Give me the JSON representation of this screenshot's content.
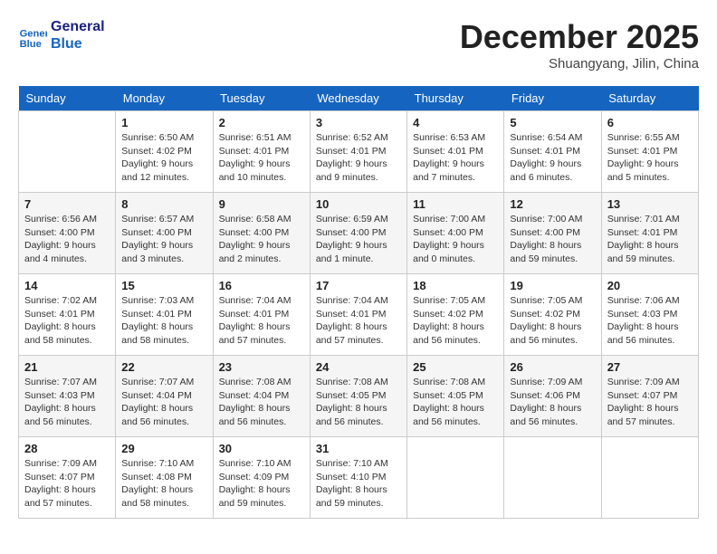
{
  "header": {
    "logo_line1": "General",
    "logo_line2": "Blue",
    "month": "December 2025",
    "location": "Shuangyang, Jilin, China"
  },
  "weekdays": [
    "Sunday",
    "Monday",
    "Tuesday",
    "Wednesday",
    "Thursday",
    "Friday",
    "Saturday"
  ],
  "weeks": [
    [
      {
        "day": null
      },
      {
        "day": 1,
        "sunrise": "6:50 AM",
        "sunset": "4:02 PM",
        "daylight": "9 hours and 12 minutes."
      },
      {
        "day": 2,
        "sunrise": "6:51 AM",
        "sunset": "4:01 PM",
        "daylight": "9 hours and 10 minutes."
      },
      {
        "day": 3,
        "sunrise": "6:52 AM",
        "sunset": "4:01 PM",
        "daylight": "9 hours and 9 minutes."
      },
      {
        "day": 4,
        "sunrise": "6:53 AM",
        "sunset": "4:01 PM",
        "daylight": "9 hours and 7 minutes."
      },
      {
        "day": 5,
        "sunrise": "6:54 AM",
        "sunset": "4:01 PM",
        "daylight": "9 hours and 6 minutes."
      },
      {
        "day": 6,
        "sunrise": "6:55 AM",
        "sunset": "4:01 PM",
        "daylight": "9 hours and 5 minutes."
      }
    ],
    [
      {
        "day": 7,
        "sunrise": "6:56 AM",
        "sunset": "4:00 PM",
        "daylight": "9 hours and 4 minutes."
      },
      {
        "day": 8,
        "sunrise": "6:57 AM",
        "sunset": "4:00 PM",
        "daylight": "9 hours and 3 minutes."
      },
      {
        "day": 9,
        "sunrise": "6:58 AM",
        "sunset": "4:00 PM",
        "daylight": "9 hours and 2 minutes."
      },
      {
        "day": 10,
        "sunrise": "6:59 AM",
        "sunset": "4:00 PM",
        "daylight": "9 hours and 1 minute."
      },
      {
        "day": 11,
        "sunrise": "7:00 AM",
        "sunset": "4:00 PM",
        "daylight": "9 hours and 0 minutes."
      },
      {
        "day": 12,
        "sunrise": "7:00 AM",
        "sunset": "4:00 PM",
        "daylight": "8 hours and 59 minutes."
      },
      {
        "day": 13,
        "sunrise": "7:01 AM",
        "sunset": "4:01 PM",
        "daylight": "8 hours and 59 minutes."
      }
    ],
    [
      {
        "day": 14,
        "sunrise": "7:02 AM",
        "sunset": "4:01 PM",
        "daylight": "8 hours and 58 minutes."
      },
      {
        "day": 15,
        "sunrise": "7:03 AM",
        "sunset": "4:01 PM",
        "daylight": "8 hours and 58 minutes."
      },
      {
        "day": 16,
        "sunrise": "7:04 AM",
        "sunset": "4:01 PM",
        "daylight": "8 hours and 57 minutes."
      },
      {
        "day": 17,
        "sunrise": "7:04 AM",
        "sunset": "4:01 PM",
        "daylight": "8 hours and 57 minutes."
      },
      {
        "day": 18,
        "sunrise": "7:05 AM",
        "sunset": "4:02 PM",
        "daylight": "8 hours and 56 minutes."
      },
      {
        "day": 19,
        "sunrise": "7:05 AM",
        "sunset": "4:02 PM",
        "daylight": "8 hours and 56 minutes."
      },
      {
        "day": 20,
        "sunrise": "7:06 AM",
        "sunset": "4:03 PM",
        "daylight": "8 hours and 56 minutes."
      }
    ],
    [
      {
        "day": 21,
        "sunrise": "7:07 AM",
        "sunset": "4:03 PM",
        "daylight": "8 hours and 56 minutes."
      },
      {
        "day": 22,
        "sunrise": "7:07 AM",
        "sunset": "4:04 PM",
        "daylight": "8 hours and 56 minutes."
      },
      {
        "day": 23,
        "sunrise": "7:08 AM",
        "sunset": "4:04 PM",
        "daylight": "8 hours and 56 minutes."
      },
      {
        "day": 24,
        "sunrise": "7:08 AM",
        "sunset": "4:05 PM",
        "daylight": "8 hours and 56 minutes."
      },
      {
        "day": 25,
        "sunrise": "7:08 AM",
        "sunset": "4:05 PM",
        "daylight": "8 hours and 56 minutes."
      },
      {
        "day": 26,
        "sunrise": "7:09 AM",
        "sunset": "4:06 PM",
        "daylight": "8 hours and 56 minutes."
      },
      {
        "day": 27,
        "sunrise": "7:09 AM",
        "sunset": "4:07 PM",
        "daylight": "8 hours and 57 minutes."
      }
    ],
    [
      {
        "day": 28,
        "sunrise": "7:09 AM",
        "sunset": "4:07 PM",
        "daylight": "8 hours and 57 minutes."
      },
      {
        "day": 29,
        "sunrise": "7:10 AM",
        "sunset": "4:08 PM",
        "daylight": "8 hours and 58 minutes."
      },
      {
        "day": 30,
        "sunrise": "7:10 AM",
        "sunset": "4:09 PM",
        "daylight": "8 hours and 59 minutes."
      },
      {
        "day": 31,
        "sunrise": "7:10 AM",
        "sunset": "4:10 PM",
        "daylight": "8 hours and 59 minutes."
      },
      {
        "day": null
      },
      {
        "day": null
      },
      {
        "day": null
      }
    ]
  ],
  "labels": {
    "sunrise": "Sunrise:",
    "sunset": "Sunset:",
    "daylight": "Daylight:"
  }
}
